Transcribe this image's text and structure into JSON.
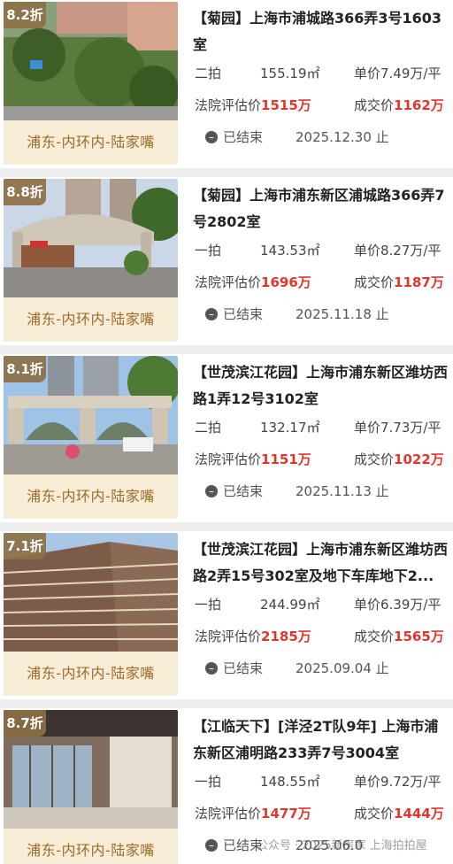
{
  "listings": [
    {
      "discount": "8.2折",
      "location": "浦东-内环内-陆家嘴",
      "title": "【菊园】上海市浦城路366弄3号1603室",
      "round": "二拍",
      "area": "155.19㎡",
      "unit_price": "单价7.49万/平",
      "court_label": "法院评估价",
      "court_value": "1515万",
      "deal_label": "成交价",
      "deal_value": "1162万",
      "status": "已结束",
      "end_date": "2025.12.30 止"
    },
    {
      "discount": "8.8折",
      "location": "浦东-内环内-陆家嘴",
      "title": "【菊园】上海市浦东新区浦城路366弄7号2802室",
      "round": "一拍",
      "area": "143.53㎡",
      "unit_price": "单价8.27万/平",
      "court_label": "法院评估价",
      "court_value": "1696万",
      "deal_label": "成交价",
      "deal_value": "1187万",
      "status": "已结束",
      "end_date": "2025.11.18 止"
    },
    {
      "discount": "8.1折",
      "location": "浦东-内环内-陆家嘴",
      "title": "【世茂滨江花园】上海市浦东新区潍坊西路1弄12号3102室",
      "round": "二拍",
      "area": "132.17㎡",
      "unit_price": "单价7.73万/平",
      "court_label": "法院评估价",
      "court_value": "1151万",
      "deal_label": "成交价",
      "deal_value": "1022万",
      "status": "已结束",
      "end_date": "2025.11.13 止"
    },
    {
      "discount": "7.1折",
      "location": "浦东-内环内-陆家嘴",
      "title": "【世茂滨江花园】上海市浦东新区潍坊西路2弄15号302室及地下车库地下2...",
      "round": "一拍",
      "area": "244.99㎡",
      "unit_price": "单价6.39万/平",
      "court_label": "法院评估价",
      "court_value": "2185万",
      "deal_label": "成交价",
      "deal_value": "1565万",
      "status": "已结束",
      "end_date": "2025.09.04 止"
    },
    {
      "discount": "8.7折",
      "location": "浦东-内环内-陆家嘴",
      "title": "【江临天下】[洋泾2T队9年] 上海市浦东新区浦明路233弄7号3004室",
      "round": "一拍",
      "area": "148.55㎡",
      "unit_price": "单价9.72万/平",
      "court_label": "法院评估价",
      "court_value": "1477万",
      "deal_label": "成交价",
      "deal_value": "1444万",
      "status": "已结束",
      "end_date": "2025.06.0"
    }
  ],
  "watermark": "公众号 · 2025新房家 上海拍拍屋",
  "icons": {
    "status": "clock-icon"
  },
  "colors": {
    "accent_red": "#e0372c",
    "location_bg": "#f7ecd6",
    "location_text": "#a06a2c",
    "badge_bg": "#8c7046"
  }
}
